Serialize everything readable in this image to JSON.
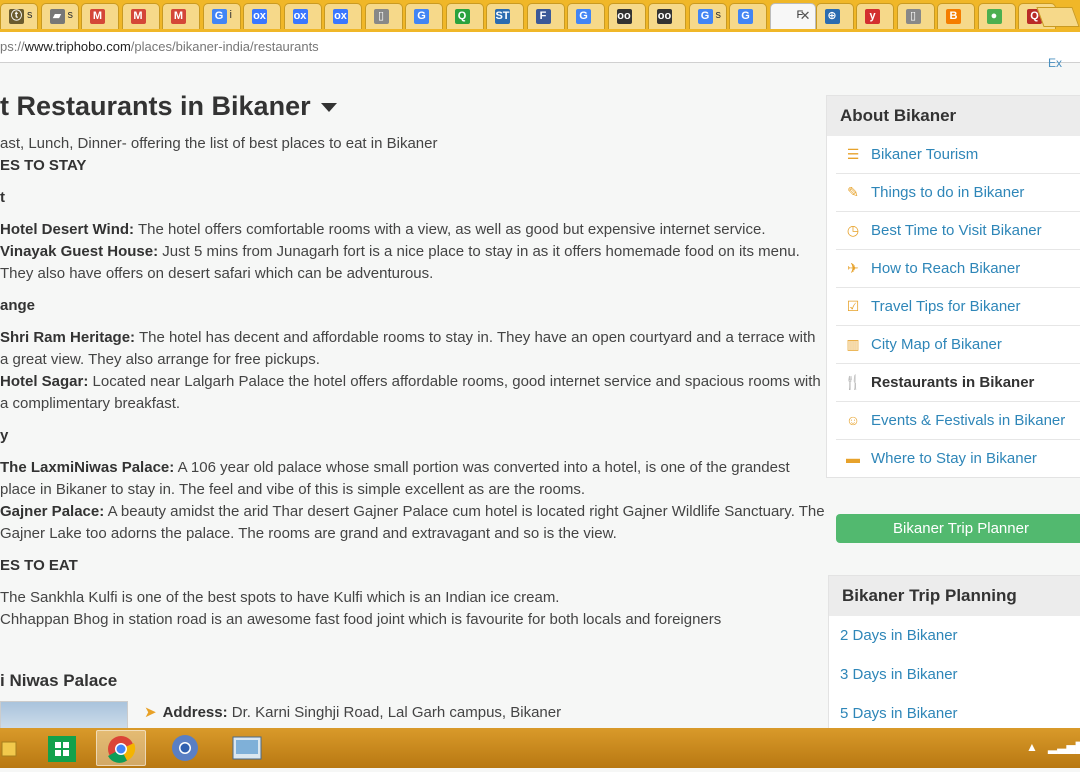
{
  "browser": {
    "url_prefix": "ps://",
    "url_host": "www.triphobo.com",
    "url_path": "/places/bikaner-india/restaurants",
    "tabs": [
      {
        "favicon": "triphobo-icon",
        "glyph": "ⓣ",
        "color": "#6b5b2d",
        "label": "s"
      },
      {
        "favicon": "bookmark-icon",
        "glyph": "▰",
        "color": "#777",
        "label": "s"
      },
      {
        "favicon": "gmail-icon",
        "glyph": "M",
        "color": "#d44638",
        "label": ""
      },
      {
        "favicon": "gmail-icon",
        "glyph": "M",
        "color": "#d44638",
        "label": ""
      },
      {
        "favicon": "gmail-icon",
        "glyph": "M",
        "color": "#d44638",
        "label": ""
      },
      {
        "favicon": "google-icon",
        "glyph": "G",
        "color": "#4285f4",
        "label": "i"
      },
      {
        "favicon": "olx-icon",
        "glyph": "ox",
        "color": "#3a77ff",
        "label": ""
      },
      {
        "favicon": "olx-icon",
        "glyph": "ox",
        "color": "#3a77ff",
        "label": ""
      },
      {
        "favicon": "olx-icon",
        "glyph": "ox",
        "color": "#3a77ff",
        "label": ""
      },
      {
        "favicon": "document-icon",
        "glyph": "▯",
        "color": "#888",
        "label": ""
      },
      {
        "favicon": "google-icon",
        "glyph": "G",
        "color": "#4285f4",
        "label": ""
      },
      {
        "favicon": "quora-icon",
        "glyph": "Q",
        "color": "#2aa23d",
        "label": ""
      },
      {
        "favicon": "st-icon",
        "glyph": "ST",
        "color": "#2b6cb0",
        "label": ""
      },
      {
        "favicon": "facebook-icon",
        "glyph": "F",
        "color": "#3b5998",
        "label": ""
      },
      {
        "favicon": "google-icon",
        "glyph": "G",
        "color": "#4285f4",
        "label": ""
      },
      {
        "favicon": "tripadvisor-icon",
        "glyph": "oo",
        "color": "#333",
        "label": ""
      },
      {
        "favicon": "tripadvisor-icon",
        "glyph": "oo",
        "color": "#333",
        "label": ""
      },
      {
        "favicon": "google-icon",
        "glyph": "G",
        "color": "#4285f4",
        "label": "s"
      },
      {
        "favicon": "google-icon",
        "glyph": "G",
        "color": "#4285f4",
        "label": ""
      },
      {
        "favicon": "active-tab",
        "glyph": "",
        "color": "#777",
        "label": "F"
      },
      {
        "favicon": "plus-circle-icon",
        "glyph": "⊕",
        "color": "#2b6cb0",
        "label": ""
      },
      {
        "favicon": "yahoo-icon",
        "glyph": "y",
        "color": "#d32f2f",
        "label": ""
      },
      {
        "favicon": "document-icon",
        "glyph": "▯",
        "color": "#888",
        "label": ""
      },
      {
        "favicon": "blogger-icon",
        "glyph": "B",
        "color": "#f57d00",
        "label": ""
      },
      {
        "favicon": "globe-icon",
        "glyph": "●",
        "color": "#4caf50",
        "label": ""
      },
      {
        "favicon": "quora-icon",
        "glyph": "Q",
        "color": "#b92b27",
        "label": ""
      }
    ]
  },
  "page": {
    "title": "t Restaurants in Bikaner",
    "subtitle": "ast, Lunch, Dinner- offering the list of best places to eat in Bikaner",
    "section_stay": "ES TO STAY",
    "cat_1": "t",
    "item_1_name": "Hotel Desert Wind:",
    "item_1_text": " The hotel offers comfortable rooms with a view, as well as good but expensive internet service.",
    "item_2_name": "Vinayak Guest House:",
    "item_2_text": " Just 5 mins from Junagarh fort is a nice place to stay in as it offers homemade food on its menu.",
    "item_2_cont": "They also have offers on desert safari which can be adventurous.",
    "cat_2": "ange",
    "item_3_name": "Shri Ram Heritage:",
    "item_3_text": " The hotel has decent and affordable rooms to stay in. They have an open courtyard and a terrace with",
    "item_3_cont": "a great view. They also arrange for free pickups.",
    "item_4_name": "Hotel Sagar:",
    "item_4_text": " Located near Lalgarh Palace the hotel offers affordable rooms, good internet service and spacious rooms with",
    "item_4_cont": "a complimentary breakfast.",
    "cat_3": "y",
    "item_5_name": "The LaxmiNiwas Palace:",
    "item_5_text": " A 106 year old palace whose small portion was converted into a hotel, is one of the grandest",
    "item_5_cont": "place in Bikaner to stay in. The feel and vibe of this is simple excellent as are the rooms.",
    "item_6_name": "Gajner Palace:",
    "item_6_text": " A beauty amidst the arid Thar desert Gajner Palace cum hotel is located right Gajner Wildlife Sanctuary. The",
    "item_6_cont": "Gajner Lake too adorns the palace. The rooms are grand and extravagant and so is the view.",
    "section_eat": "ES TO EAT",
    "eat_1": "The Sankhla Kulfi is one of the best spots to have Kulfi which is an Indian ice cream.",
    "eat_2": "Chhappan Bhog in station road is an awesome fast food joint which is favourite for both locals and foreigners",
    "place_title": "i Niwas Palace",
    "address_label": "Address:",
    "address_value": " Dr. Karni Singhji Road, Lal Garh campus, Bikaner",
    "ext_fragment": "Ex"
  },
  "sidebar": {
    "about_title": "About Bikaner",
    "items": [
      {
        "label": "Bikaner Tourism",
        "icon": "list-icon",
        "glyph": "☰",
        "name": "sidebar-item-tourism"
      },
      {
        "label": "Things to do in Bikaner",
        "icon": "edit-icon",
        "glyph": "✎",
        "name": "sidebar-item-things-to-do"
      },
      {
        "label": "Best Time to Visit Bikaner",
        "icon": "clock-icon",
        "glyph": "◷",
        "name": "sidebar-item-best-time"
      },
      {
        "label": "How to Reach Bikaner",
        "icon": "plane-icon",
        "glyph": "✈",
        "name": "sidebar-item-how-to-reach"
      },
      {
        "label": "Travel Tips for Bikaner",
        "icon": "checkbox-icon",
        "glyph": "☑",
        "name": "sidebar-item-travel-tips"
      },
      {
        "label": "City Map of Bikaner",
        "icon": "map-icon",
        "glyph": "▥",
        "name": "sidebar-item-city-map"
      },
      {
        "label": "Restaurants in Bikaner",
        "icon": "cutlery-icon",
        "glyph": "🍴",
        "name": "sidebar-item-restaurants"
      },
      {
        "label": "Events & Festivals in Bikaner",
        "icon": "smile-icon",
        "glyph": "☺",
        "name": "sidebar-item-events"
      },
      {
        "label": "Where to Stay in Bikaner",
        "icon": "bed-icon",
        "glyph": "▬",
        "name": "sidebar-item-where-to-stay"
      }
    ],
    "planner_button": "Bikaner Trip Planner",
    "planning_title": "Bikaner Trip Planning",
    "planning_links": [
      "2 Days in Bikaner",
      "3 Days in Bikaner",
      "5 Days in Bikaner"
    ]
  },
  "taskbar": {
    "apps": [
      "file-explorer-icon",
      "store-icon",
      "chrome-icon",
      "chrome-icon",
      "photos-icon"
    ]
  }
}
